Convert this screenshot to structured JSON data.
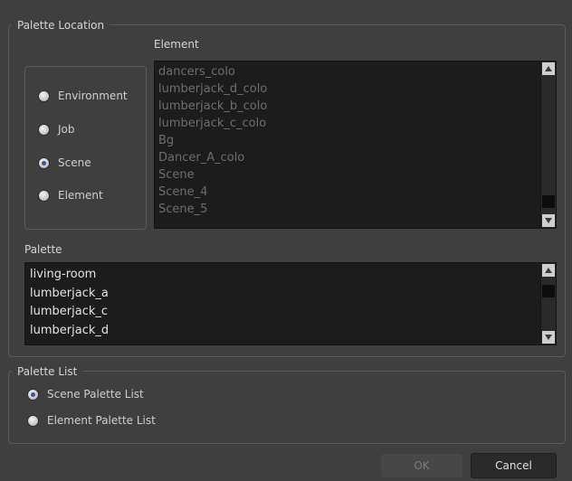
{
  "palette_location": {
    "title": "Palette Location",
    "element_label": "Element",
    "radios": [
      {
        "label": "Environment",
        "checked": false
      },
      {
        "label": "Job",
        "checked": false
      },
      {
        "label": "Scene",
        "checked": true
      },
      {
        "label": "Element",
        "checked": false
      }
    ],
    "element_list": [
      "dancers_colo",
      "lumberjack_d_colo",
      "lumberjack_b_colo",
      "lumberjack_c_colo",
      "Bg",
      "Dancer_A_colo",
      "Scene",
      "Scene_4",
      "Scene_5"
    ],
    "palette_label": "Palette",
    "palette_list": [
      "living-room",
      "lumberjack_a",
      "lumberjack_c",
      "lumberjack_d"
    ]
  },
  "palette_list_group": {
    "title": "Palette List",
    "radios": [
      {
        "label": "Scene Palette List",
        "checked": true
      },
      {
        "label": "Element Palette List",
        "checked": false
      }
    ]
  },
  "buttons": {
    "ok": "OK",
    "cancel": "Cancel"
  },
  "icons": {
    "scroll_up": "triangle-up-icon",
    "scroll_down": "triangle-down-icon"
  },
  "colors": {
    "background": "#3f3f3f",
    "list_bg": "#1c1c1c",
    "radio_dot": "#2a5aa0"
  }
}
